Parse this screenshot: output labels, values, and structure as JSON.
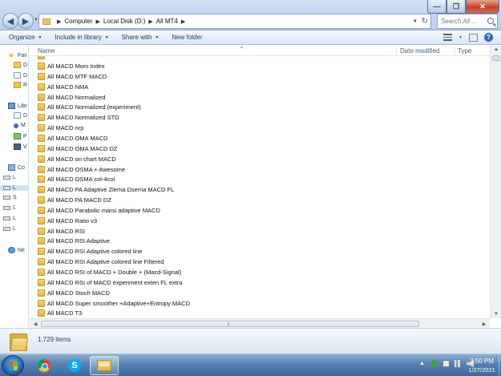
{
  "window": {
    "minimize_glyph": "—",
    "maximize_glyph": "❐",
    "close_glyph": "✕"
  },
  "address": {
    "crumbs": [
      "Computer",
      "Local Disk (D:)",
      "All MT4"
    ]
  },
  "search": {
    "placeholder": "Search All ..."
  },
  "toolbar": {
    "organize": "Organize",
    "include_in_library": "Include in library",
    "share_with": "Share with",
    "new_folder": "New folder"
  },
  "nav_pane": {
    "items": [
      {
        "label": "Fav",
        "icon": "star-icon"
      },
      {
        "label": "D",
        "icon": "folder-icon"
      },
      {
        "label": "D",
        "icon": "document-icon"
      },
      {
        "label": "R",
        "icon": "folder-icon"
      },
      {
        "label": "Libr",
        "icon": "library-icon"
      },
      {
        "label": "D",
        "icon": "document-icon"
      },
      {
        "label": "M",
        "icon": "music-icon"
      },
      {
        "label": "P",
        "icon": "picture-icon"
      },
      {
        "label": "V",
        "icon": "video-icon"
      },
      {
        "label": "Co",
        "icon": "computer-icon"
      },
      {
        "label": "L",
        "icon": "drive-icon"
      },
      {
        "label": "L",
        "icon": "drive-icon"
      },
      {
        "label": "S",
        "icon": "drive-icon"
      },
      {
        "label": "L",
        "icon": "drive-icon"
      },
      {
        "label": "L",
        "icon": "drive-icon"
      },
      {
        "label": "L",
        "icon": "drive-icon"
      },
      {
        "label": "Ne",
        "icon": "network-icon"
      }
    ]
  },
  "columns": {
    "name": "Name",
    "date_modified": "Date modified",
    "type": "Type"
  },
  "files": [
    "All MACD Mom Index",
    "All MACD MTF MACD",
    "All MACD NMA",
    "All MACD Normalized",
    "All MACD Normalized (experiment)",
    "All MACD Normalized STD",
    "All MACD nrp",
    "All MACD OMA MACD",
    "All MACD OMA MACD DZ",
    "All MACD on chart MACD",
    "All MACD OSMA + Awesome",
    "All MACD OSMA col-4col",
    "All MACD PA Adaptive Zlema Dsema MACD FL",
    "All MACD PA MACD DZ",
    "All MACD Parabolic marsi adaptive MACD",
    "All MACD Ratio v3",
    "All MACD RSI",
    "All MACD RSI Adaptive",
    "All MACD RSI Adaptive colored line",
    "All MACD RSI Adaptive colored line Filtered",
    "All MACD RSI of MACD + Double + (Macd-Signal)",
    "All MACD RSI of MACD experiment exten FL extra",
    "All MACD Stoch MACD",
    "All MACD Super smoother +Adaptive+Entropy MACD",
    "All MACD T3"
  ],
  "status": {
    "item_count": "1,729 items"
  },
  "taskbar": {
    "time": "3:50 PM",
    "date": "1/27/2021",
    "tray_up": "▲"
  },
  "colors": {
    "folder": "#e7c864",
    "accent": "#1e395b",
    "taskbar": "#4a74a8"
  }
}
